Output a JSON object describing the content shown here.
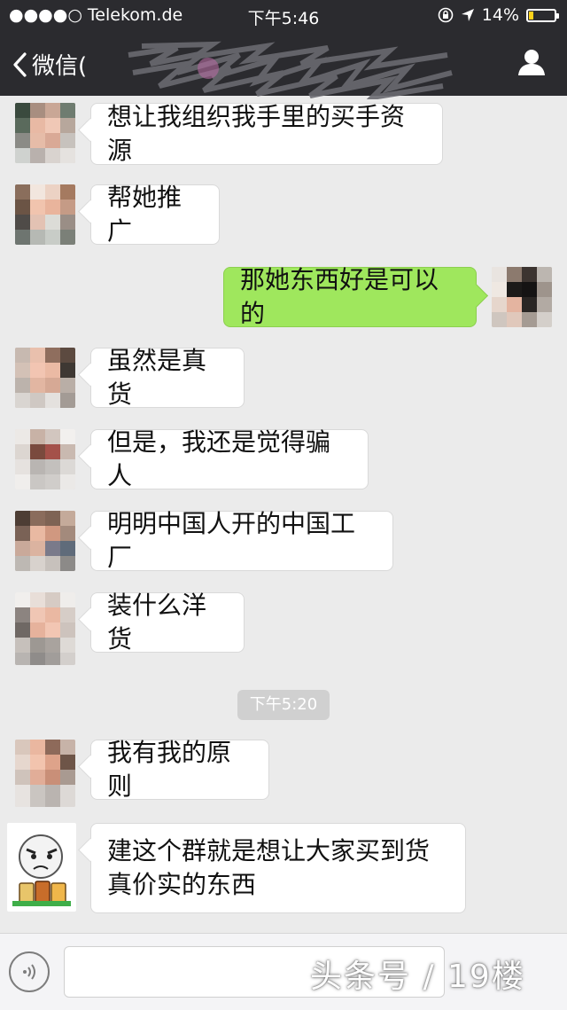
{
  "status_bar": {
    "carrier": "●●●●○ Telekom.de",
    "time": "下午5:46",
    "battery": "14%",
    "battery_level": 0.14
  },
  "nav": {
    "back_label": "微信("
  },
  "messages": [
    {
      "text": "想让我组织我手里的买手资源"
    },
    {
      "text": "帮她推广"
    },
    {
      "text": "那她东西好是可以的"
    },
    {
      "text": "虽然是真货"
    },
    {
      "text": "但是，我还是觉得骗人"
    },
    {
      "text": "明明中国人开的中国工厂"
    },
    {
      "text": "装什么洋货"
    },
    {
      "text": "我有我的原则"
    },
    {
      "text": "建这个群就是想让大家买到货真价实的东西"
    }
  ],
  "timestamp": "下午5:20",
  "watermark": "头条号 / 19楼",
  "colors": {
    "header": "#2b2b2f",
    "chat_bg": "#ebebeb",
    "sent_bubble": "#9fe75d",
    "received_bubble": "#ffffff"
  }
}
